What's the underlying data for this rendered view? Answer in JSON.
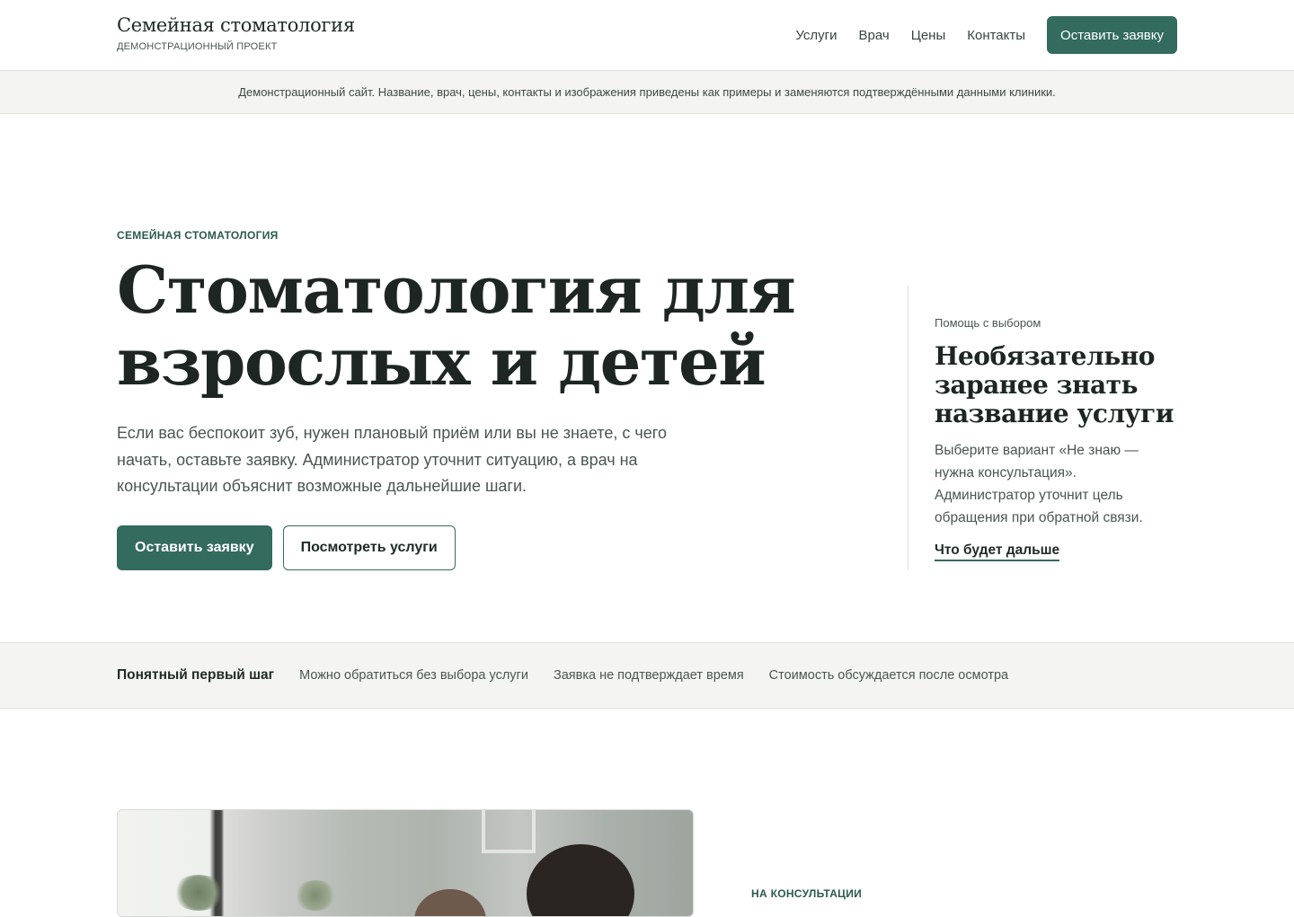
{
  "header": {
    "brand_title": "Семейная стоматология",
    "brand_subtitle": "ДЕМОНСТРАЦИОННЫЙ ПРОЕКТ",
    "nav": [
      {
        "label": "Услуги"
      },
      {
        "label": "Врач"
      },
      {
        "label": "Цены"
      },
      {
        "label": "Контакты"
      }
    ],
    "cta_label": "Оставить заявку"
  },
  "notice": {
    "text": "Демонстрационный сайт. Название, врач, цены, контакты и изображения приведены как примеры и заменяются подтверждёнными данными клиники."
  },
  "hero": {
    "eyebrow": "СЕМЕЙНАЯ СТОМАТОЛОГИЯ",
    "title": "Стоматология для взрослых и детей",
    "text": "Если вас беспокоит зуб, нужен плановый приём или вы не знаете, с чего начать, оставьте заявку. Администратор уточнит ситуацию, а врач на консультации объяснит возможные дальнейшие шаги.",
    "primary_button": "Оставить заявку",
    "secondary_button": "Посмотреть услуги"
  },
  "help": {
    "label": "Помощь с выбором",
    "title": "Необязательно заранее знать название услуги",
    "text": "Выберите вариант «Не знаю — нужна консультация». Администратор уточнит цель обращения при обратной связи.",
    "link": "Что будет дальше"
  },
  "strip": {
    "title": "Понятный первый шаг",
    "items": [
      "Можно обратиться без выбора услуги",
      "Заявка не подтверждает время",
      "Стоимость обсуждается после осмотра"
    ]
  },
  "consultation": {
    "eyebrow": "НА КОНСУЛЬТАЦИИ"
  },
  "colors": {
    "accent": "#336b5e",
    "accent_text": "#2a5a4e",
    "surface_alt": "#f4f5f2",
    "text": "#1f2a26",
    "muted": "#4b5551"
  }
}
